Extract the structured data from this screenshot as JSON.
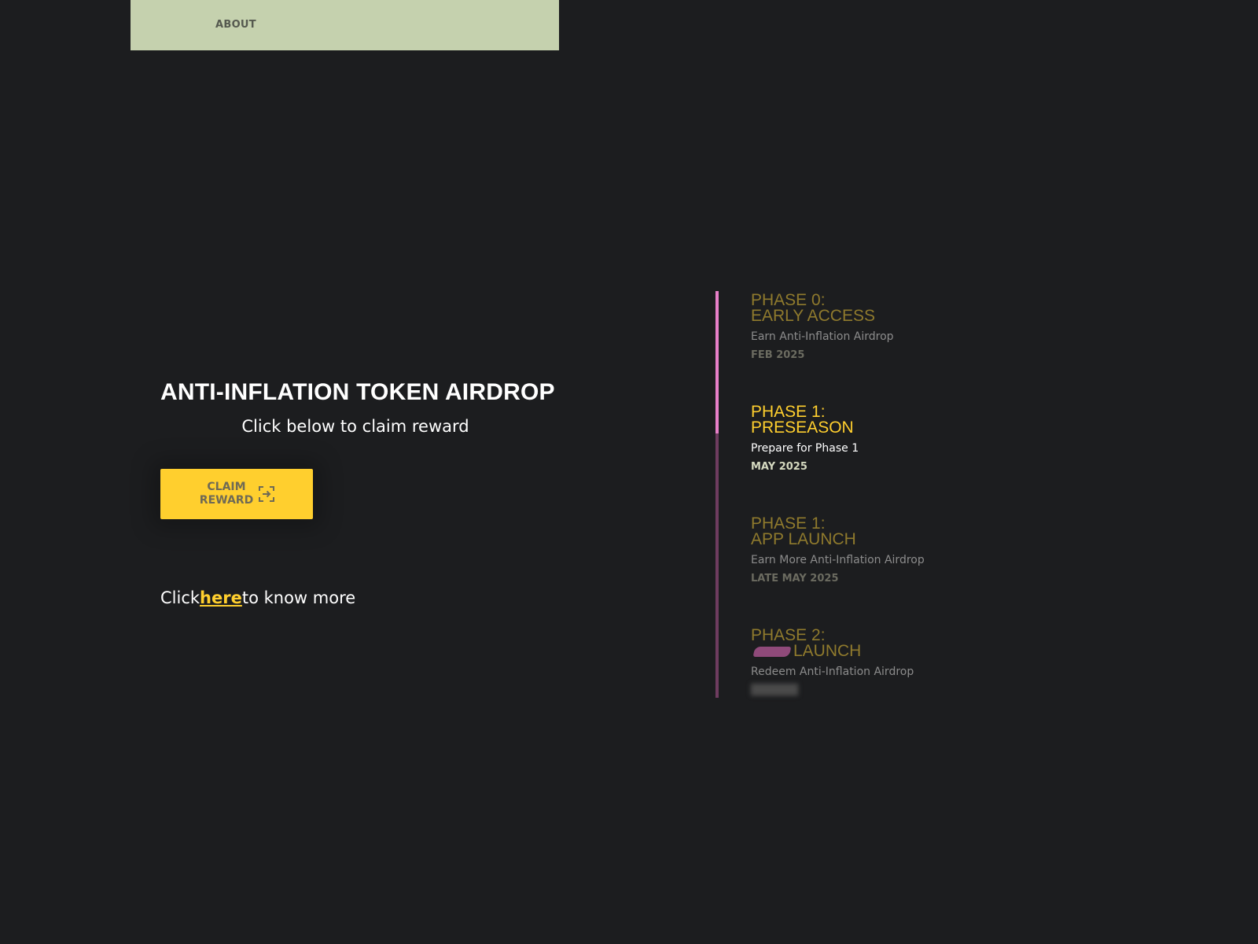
{
  "nav": {
    "about_label": "ABOUT"
  },
  "hero": {
    "title": "ANTI-INFLATION TOKEN AIRDROP",
    "subtitle": "Click below to claim reward",
    "claim_button_label": "CLAIM\nREWARD",
    "claim_icon": "enter-frame-icon",
    "know_more_prefix": "Click",
    "know_more_link": "here",
    "know_more_suffix": "to know more"
  },
  "timeline": {
    "progress_fraction": 0.35,
    "phases": [
      {
        "title": "PHASE 0:\nEARLY ACCESS",
        "description": "Earn Anti-Inflation Airdrop",
        "date": "FEB 2025",
        "active": false
      },
      {
        "title": "PHASE 1:\nPRESEASON",
        "description": "Prepare for Phase 1",
        "date": "MAY 2025",
        "active": true
      },
      {
        "title": "PHASE 1:\nAPP LAUNCH",
        "description": "Earn More Anti-Inflation Airdrop",
        "date": "LATE MAY 2025",
        "active": false
      },
      {
        "title_line1": "PHASE 2:",
        "title_line2": "LAUNCH",
        "description": "Redeem Anti-Inflation Airdrop",
        "active": false
      }
    ]
  },
  "colors": {
    "background": "#1c1d1f",
    "nav_bg": "#c5d1ae",
    "accent_yellow": "#ffcf2e",
    "timeline_pink": "#e77fc8",
    "timeline_track": "#6e3c5f"
  }
}
